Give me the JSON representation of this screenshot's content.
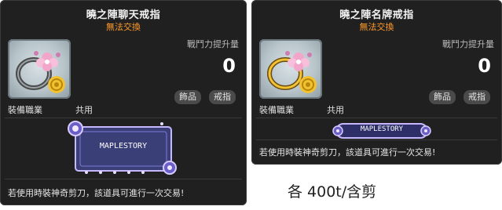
{
  "cards": [
    {
      "title": "曉之陣聊天戒指",
      "subtitle": "無法交換",
      "power_label": "戰鬥力提升量",
      "power_value": "0",
      "tags": [
        "飾品",
        "戒指"
      ],
      "job_label": "裝備職業",
      "job_value": "共用",
      "plaque_text": "MAPLESTORY",
      "description": "若使用時裝神奇剪刀，該道具可進行一次交易!"
    },
    {
      "title": "曉之陣名牌戒指",
      "subtitle": "無法交換",
      "power_label": "戰鬥力提升量",
      "power_value": "0",
      "tags": [
        "飾品",
        "戒指"
      ],
      "job_label": "裝備職業",
      "job_value": "共用",
      "plaque_text": "MAPLESTORY",
      "description": "若使用時裝神奇剪刀，該道具可進行一次交易!"
    }
  ],
  "caption": "各 400t/含剪",
  "colors": {
    "card_bg": "#202020",
    "subtitle": "#ff9a2a",
    "plaque_fill": "#3b3f78",
    "plaque_border": "#c7b7ff"
  },
  "icons": [
    "ring-icon",
    "flower-ornament-icon",
    "gold-coin-icon"
  ]
}
